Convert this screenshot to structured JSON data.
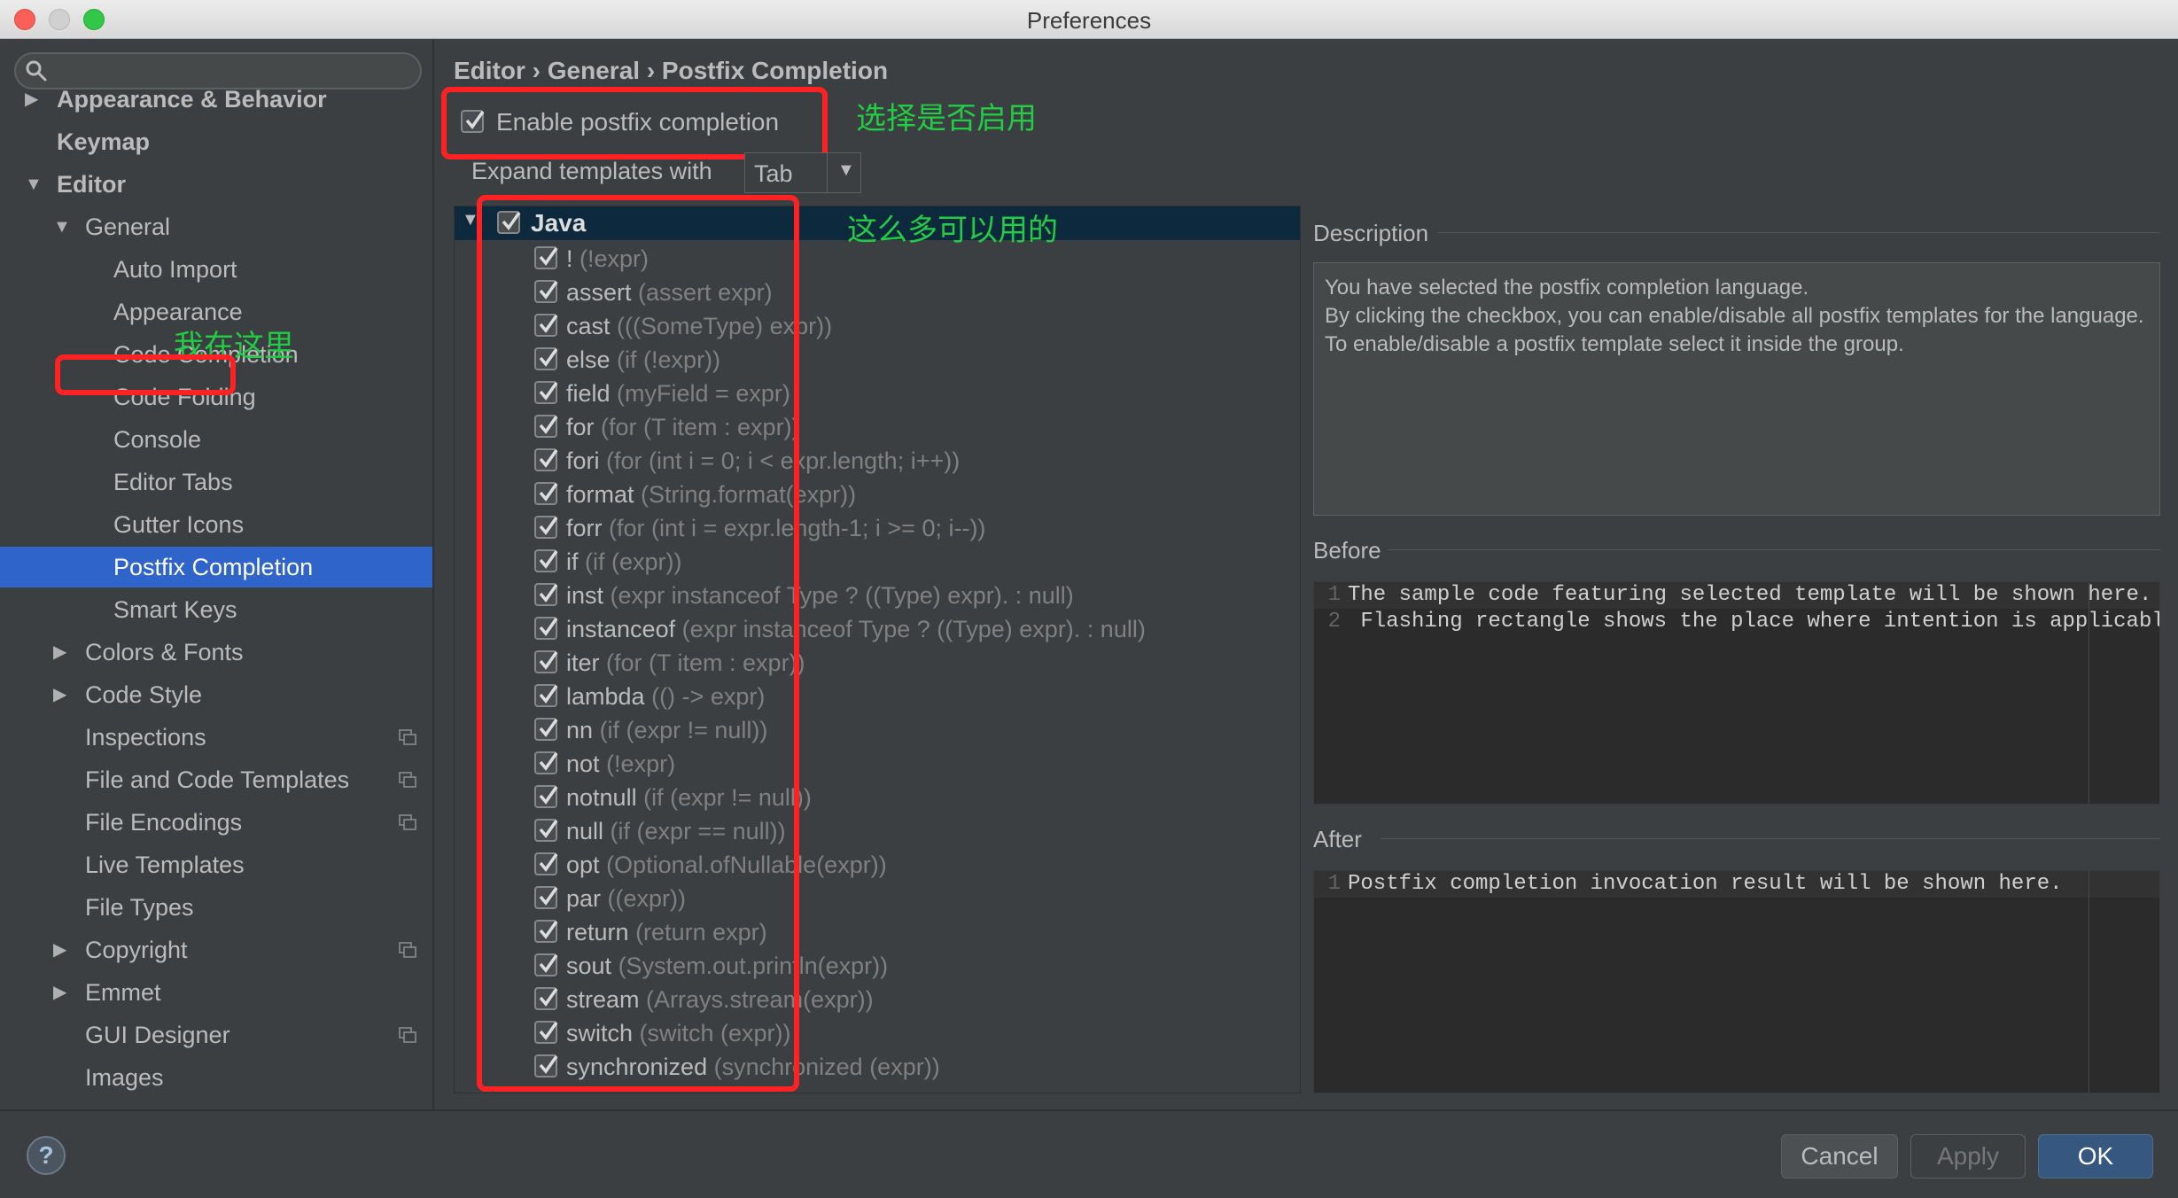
{
  "window": {
    "title": "Preferences"
  },
  "sidebar": {
    "search_placeholder": "",
    "items": [
      {
        "label": "Appearance & Behavior",
        "level": 0,
        "bold": true,
        "arrow": "right"
      },
      {
        "label": "Keymap",
        "level": 0,
        "bold": true,
        "arrow": ""
      },
      {
        "label": "Editor",
        "level": 0,
        "bold": true,
        "arrow": "down"
      },
      {
        "label": "General",
        "level": 1,
        "bold": false,
        "arrow": "down"
      },
      {
        "label": "Auto Import",
        "level": 2,
        "bold": false,
        "arrow": ""
      },
      {
        "label": "Appearance",
        "level": 2,
        "bold": false,
        "arrow": ""
      },
      {
        "label": "Code Completion",
        "level": 2,
        "bold": false,
        "arrow": ""
      },
      {
        "label": "Code Folding",
        "level": 2,
        "bold": false,
        "arrow": ""
      },
      {
        "label": "Console",
        "level": 2,
        "bold": false,
        "arrow": ""
      },
      {
        "label": "Editor Tabs",
        "level": 2,
        "bold": false,
        "arrow": ""
      },
      {
        "label": "Gutter Icons",
        "level": 2,
        "bold": false,
        "arrow": ""
      },
      {
        "label": "Postfix Completion",
        "level": 2,
        "bold": false,
        "arrow": "",
        "selected": true
      },
      {
        "label": "Smart Keys",
        "level": 2,
        "bold": false,
        "arrow": ""
      },
      {
        "label": "Colors & Fonts",
        "level": 1,
        "bold": false,
        "arrow": "right"
      },
      {
        "label": "Code Style",
        "level": 1,
        "bold": false,
        "arrow": "right"
      },
      {
        "label": "Inspections",
        "level": 1,
        "bold": false,
        "arrow": "",
        "project_icon": true
      },
      {
        "label": "File and Code Templates",
        "level": 1,
        "bold": false,
        "arrow": "",
        "project_icon": true
      },
      {
        "label": "File Encodings",
        "level": 1,
        "bold": false,
        "arrow": "",
        "project_icon": true
      },
      {
        "label": "Live Templates",
        "level": 1,
        "bold": false,
        "arrow": ""
      },
      {
        "label": "File Types",
        "level": 1,
        "bold": false,
        "arrow": ""
      },
      {
        "label": "Copyright",
        "level": 1,
        "bold": false,
        "arrow": "right",
        "project_icon": true
      },
      {
        "label": "Emmet",
        "level": 1,
        "bold": false,
        "arrow": "right"
      },
      {
        "label": "GUI Designer",
        "level": 1,
        "bold": false,
        "arrow": "",
        "project_icon": true
      },
      {
        "label": "Images",
        "level": 1,
        "bold": false,
        "arrow": ""
      }
    ],
    "annotation": "我在这里"
  },
  "main": {
    "breadcrumb": "Editor › General › Postfix Completion",
    "enable_label": "Enable postfix completion",
    "enable_checked": true,
    "enable_annotation": "选择是否启用",
    "expand_label": "Expand templates with",
    "expand_value": "Tab",
    "templates_annotation": "这么多可以用的",
    "group": {
      "label": "Java",
      "checked": true
    },
    "templates": [
      {
        "key": "!",
        "example": "(!expr)"
      },
      {
        "key": "assert",
        "example": "(assert expr)"
      },
      {
        "key": "cast",
        "example": "(((SomeType) expr))"
      },
      {
        "key": "else",
        "example": "(if (!expr))"
      },
      {
        "key": "field",
        "example": "(myField = expr)"
      },
      {
        "key": "for",
        "example": "(for (T item : expr))"
      },
      {
        "key": "fori",
        "example": "(for (int i = 0; i < expr.length; i++))"
      },
      {
        "key": "format",
        "example": "(String.format(expr))"
      },
      {
        "key": "forr",
        "example": "(for (int i = expr.length-1; i >= 0; i--))"
      },
      {
        "key": "if",
        "example": "(if (expr))"
      },
      {
        "key": "inst",
        "example": "(expr instanceof Type ? ((Type) expr). : null)"
      },
      {
        "key": "instanceof",
        "example": "(expr instanceof Type ? ((Type) expr). : null)"
      },
      {
        "key": "iter",
        "example": "(for (T item : expr))"
      },
      {
        "key": "lambda",
        "example": "(() -> expr)"
      },
      {
        "key": "nn",
        "example": "(if (expr != null))"
      },
      {
        "key": "not",
        "example": "(!expr)"
      },
      {
        "key": "notnull",
        "example": "(if (expr != null))"
      },
      {
        "key": "null",
        "example": "(if (expr == null))"
      },
      {
        "key": "opt",
        "example": "(Optional.ofNullable(expr))"
      },
      {
        "key": "par",
        "example": "((expr))"
      },
      {
        "key": "return",
        "example": "(return expr)"
      },
      {
        "key": "sout",
        "example": "(System.out.println(expr))"
      },
      {
        "key": "stream",
        "example": "(Arrays.stream(expr))"
      },
      {
        "key": "switch",
        "example": "(switch (expr))"
      },
      {
        "key": "synchronized",
        "example": "(synchronized (expr))"
      }
    ],
    "description": {
      "title": "Description",
      "lines": [
        "You have selected the postfix completion language.",
        "By clicking the checkbox, you can enable/disable all postfix templates for the language.",
        "To enable/disable a postfix template select it inside the group."
      ]
    },
    "before": {
      "title": "Before",
      "lines": [
        {
          "n": "1",
          "text": "The sample code featuring selected template will be shown here."
        },
        {
          "n": "2",
          "text": " Flashing rectangle shows the place where intention is applicable."
        }
      ]
    },
    "after": {
      "title": "After",
      "lines": [
        {
          "n": "1",
          "text": "Postfix completion invocation result will be shown here."
        }
      ]
    }
  },
  "footer": {
    "help": "?",
    "cancel": "Cancel",
    "apply": "Apply",
    "ok": "OK"
  }
}
